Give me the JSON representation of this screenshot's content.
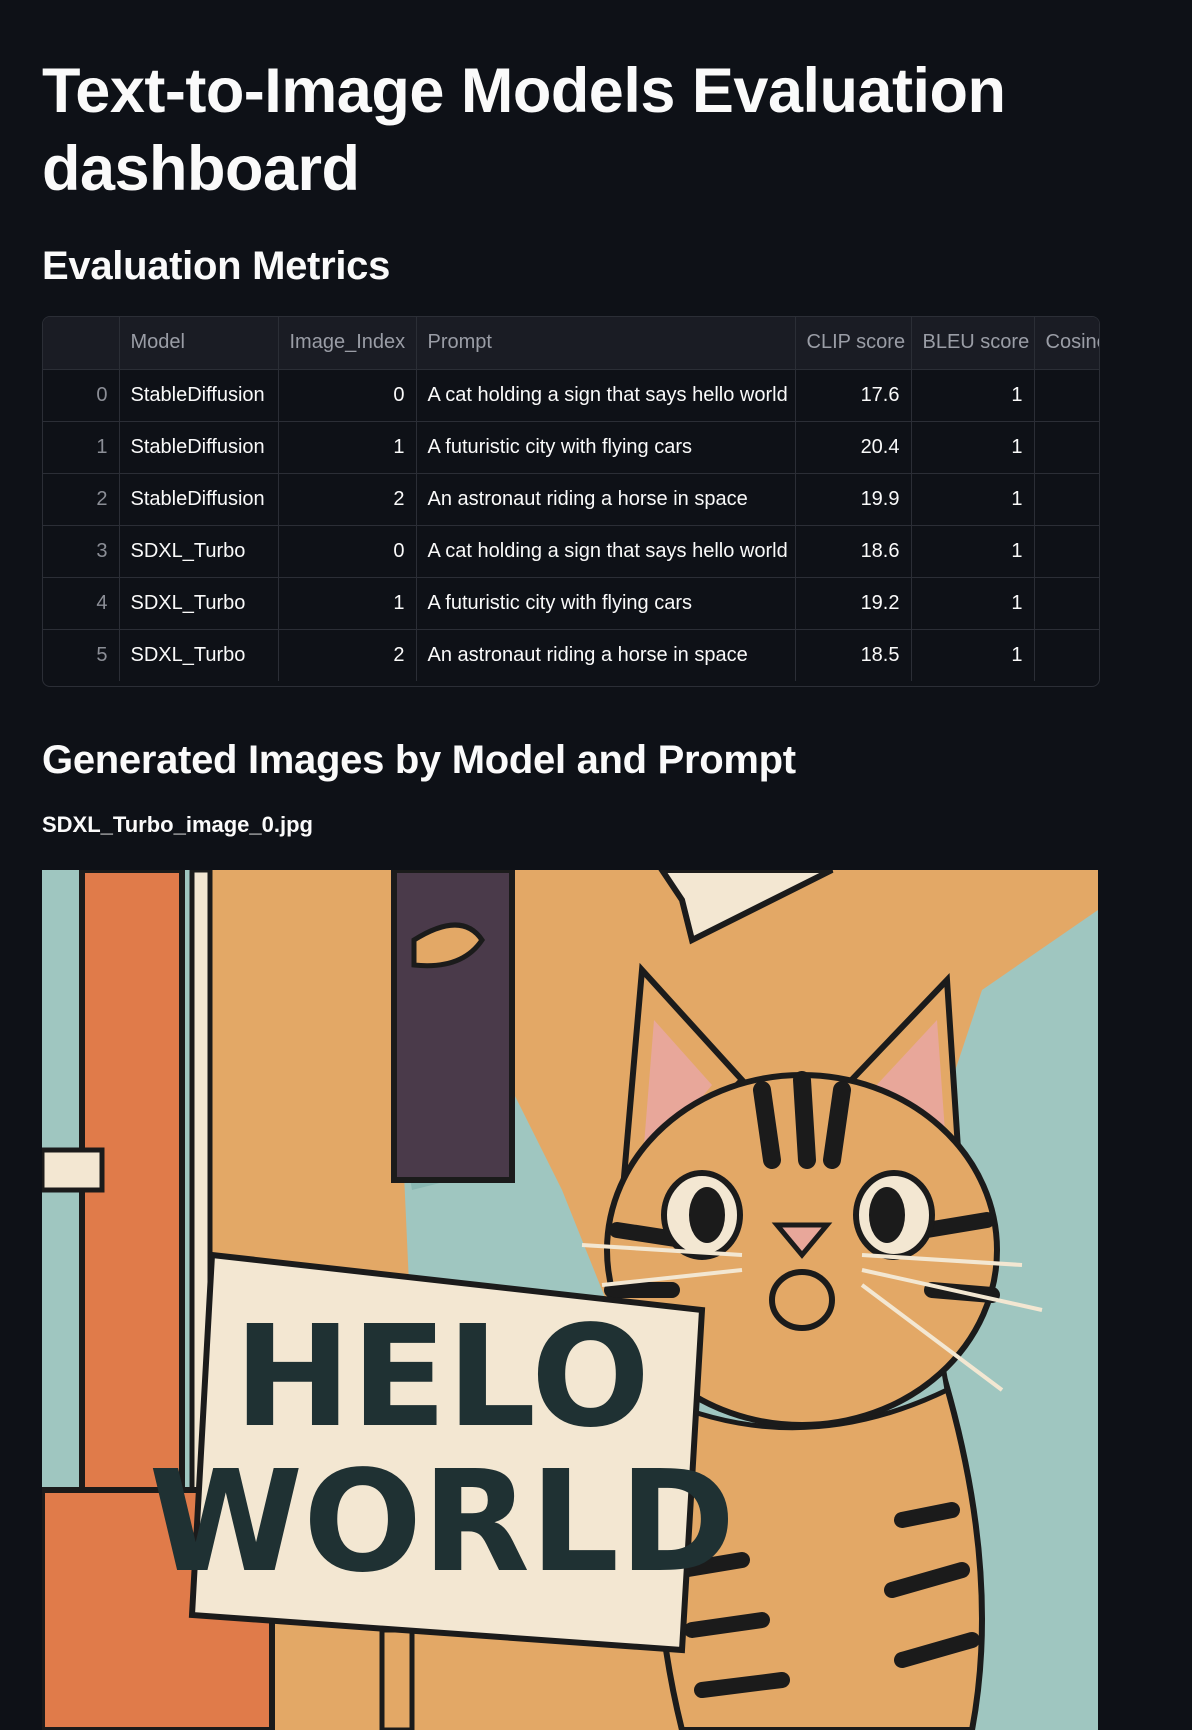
{
  "page": {
    "title": "Text-to-Image Models Evaluation dashboard"
  },
  "metrics": {
    "heading": "Evaluation Metrics",
    "columns": [
      "",
      "Model",
      "Image_Index",
      "Prompt",
      "CLIP score",
      "BLEU score",
      "Cosine"
    ],
    "rows": [
      {
        "index": "0",
        "model": "StableDiffusion",
        "image_index": "0",
        "prompt": "A cat holding a sign that says hello world",
        "clip": "17.6",
        "bleu": "1"
      },
      {
        "index": "1",
        "model": "StableDiffusion",
        "image_index": "1",
        "prompt": "A futuristic city with flying cars",
        "clip": "20.4",
        "bleu": "1"
      },
      {
        "index": "2",
        "model": "StableDiffusion",
        "image_index": "2",
        "prompt": "An astronaut riding a horse in space",
        "clip": "19.9",
        "bleu": "1"
      },
      {
        "index": "3",
        "model": "SDXL_Turbo",
        "image_index": "0",
        "prompt": "A cat holding a sign that says hello world",
        "clip": "18.6",
        "bleu": "1"
      },
      {
        "index": "4",
        "model": "SDXL_Turbo",
        "image_index": "1",
        "prompt": "A futuristic city with flying cars",
        "clip": "19.2",
        "bleu": "1"
      },
      {
        "index": "5",
        "model": "SDXL_Turbo",
        "image_index": "2",
        "prompt": "An astronaut riding a horse in space",
        "clip": "18.5",
        "bleu": "1"
      }
    ]
  },
  "gallery": {
    "heading": "Generated Images by Model and Prompt",
    "file_name": "SDXL_Turbo_image_0.jpg",
    "sign_line1": "HELO",
    "sign_line2": "WORLD"
  }
}
